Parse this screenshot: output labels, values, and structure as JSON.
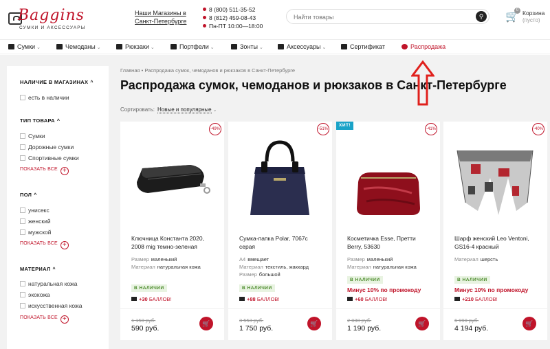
{
  "header": {
    "logo_text": "Baggins",
    "logo_sub": "СУМКИ И АКСЕССУАРЫ",
    "stores_link": "Наши Магазины в Санкт-Петербурге",
    "phone1": "8 (800) 511-35-52",
    "phone2": "8 (812) 459-08-43",
    "hours": "Пн-ПТ 10:00—18:00",
    "search_placeholder": "Найти товары",
    "cart_title": "Корзина",
    "cart_sub": "(пусто)",
    "cart_count": "0"
  },
  "nav": {
    "items": [
      {
        "label": "Сумки",
        "icon": "bag-icon",
        "has_menu": true
      },
      {
        "label": "Чемоданы",
        "icon": "suitcase-icon",
        "has_menu": true
      },
      {
        "label": "Рюкзаки",
        "icon": "backpack-icon",
        "has_menu": true
      },
      {
        "label": "Портфели",
        "icon": "briefcase-icon",
        "has_menu": true
      },
      {
        "label": "Зонты",
        "icon": "umbrella-icon",
        "has_menu": true
      },
      {
        "label": "Аксессуары",
        "icon": "wallet-icon",
        "has_menu": true
      },
      {
        "label": "Сертификат",
        "icon": "certificate-icon",
        "has_menu": false
      },
      {
        "label": "Распродажа",
        "icon": "sale-icon",
        "has_menu": false
      }
    ],
    "chevron": "⌄"
  },
  "sidebar": {
    "sections": [
      {
        "title": "НАЛИЧИЕ В МАГАЗИНАХ",
        "options": [
          "есть в наличии"
        ],
        "show_all": ""
      },
      {
        "title": "ТИП ТОВАРА",
        "options": [
          "Сумки",
          "Дорожные сумки",
          "Спортивные сумки"
        ],
        "show_all": "ПОКАЗАТЬ ВСЕ"
      },
      {
        "title": "ПОЛ",
        "options": [
          "унисекс",
          "женский",
          "мужской"
        ],
        "show_all": "ПОКАЗАТЬ ВСЕ"
      },
      {
        "title": "МАТЕРИАЛ",
        "options": [
          "натуральная кожа",
          "экокожа",
          "искусственная кожа"
        ],
        "show_all": "ПОКАЗАТЬ ВСЕ"
      }
    ]
  },
  "main": {
    "breadcrumb": [
      "Главная",
      "Распродажа сумок, чемоданов и рюкзаков в Санкт-Петербурге"
    ],
    "breadcrumb_sep": "•",
    "title": "Распродажа сумок, чемоданов и рюкзаков в Санкт-Петербурге",
    "sort_label": "Сортировать:",
    "sort_value": "Новые и популярные"
  },
  "products": [
    {
      "name": "Ключница Константа 2020, 2008 mig темно-зеленая",
      "discount": "-49%",
      "hit": "",
      "attrs": [
        {
          "k": "Размер",
          "v": "маленький"
        },
        {
          "k": "Материал",
          "v": "натуральная кожа"
        }
      ],
      "stock": "В НАЛИЧИИ",
      "promo": "",
      "bonus_amount": "+30",
      "bonus_word": "БАЛЛОВ!",
      "old_price": "1 150 руб.",
      "price": "590 руб."
    },
    {
      "name": "Сумка-папка Polar, 7067c серая",
      "discount": "-51%",
      "hit": "",
      "attrs": [
        {
          "k": "А4",
          "v": "вмещает"
        },
        {
          "k": "Материал",
          "v": "текстиль, жаккард"
        },
        {
          "k": "Размер",
          "v": "большой"
        }
      ],
      "stock": "В НАЛИЧИИ",
      "promo": "",
      "bonus_amount": "+88",
      "bonus_word": "БАЛЛОВ!",
      "old_price": "3 553 руб.",
      "price": "1 750 руб."
    },
    {
      "name": "Косметичка Esse, Претти Berry, 53630",
      "discount": "-41%",
      "hit": "ХИТ!",
      "attrs": [
        {
          "k": "Размер",
          "v": "маленький"
        },
        {
          "k": "Материал",
          "v": "натуральная кожа"
        }
      ],
      "stock": "В НАЛИЧИИ",
      "promo": "Минус 10% по промокоду",
      "bonus_amount": "+60",
      "bonus_word": "БАЛЛОВ!",
      "old_price": "2 030 руб.",
      "price": "1 190 руб."
    },
    {
      "name": "Шарф женский Leo Ventoni, GS16-4 красный",
      "discount": "-40%",
      "hit": "",
      "attrs": [
        {
          "k": "Материал",
          "v": "шерсть"
        }
      ],
      "stock": "В НАЛИЧИИ",
      "promo": "Минус 10% по промокоду",
      "bonus_amount": "+210",
      "bonus_word": "БАЛЛОВ!",
      "old_price": "6 990 руб.",
      "price": "4 194 руб."
    }
  ],
  "colors": {
    "accent": "#c0142a",
    "hit": "#1aa3c8",
    "stock_bg": "#e8f3e1",
    "stock_text": "#4a8a2a"
  }
}
